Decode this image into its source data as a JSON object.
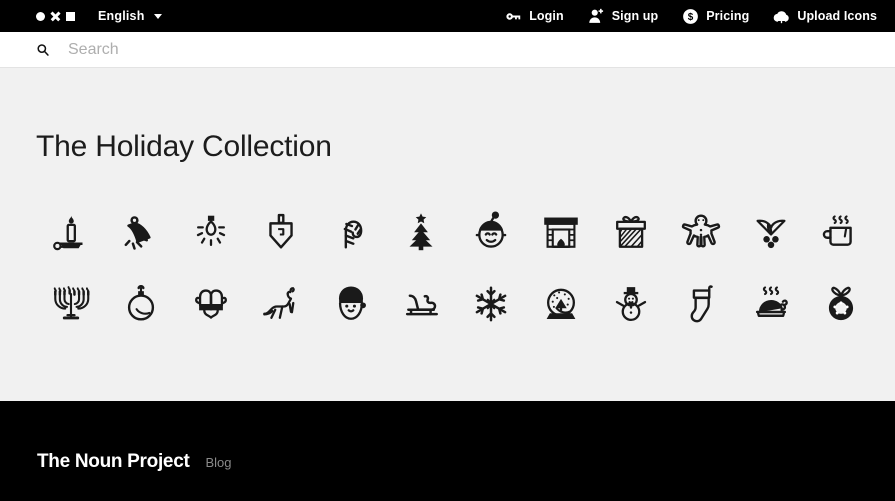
{
  "topbar": {
    "logo": {
      "name": "noun-project-logo",
      "shapes": [
        "circle",
        "x",
        "square"
      ]
    },
    "language": {
      "label": "English",
      "caret_icon": "chevron-down-icon"
    },
    "nav": [
      {
        "label": "Login",
        "icon": "key-icon"
      },
      {
        "label": "Sign up",
        "icon": "person-add-icon"
      },
      {
        "label": "Pricing",
        "icon": "dollar-circle-icon"
      },
      {
        "label": "Upload Icons",
        "icon": "cloud-upload-icon"
      }
    ]
  },
  "search": {
    "icon": "search-icon",
    "value": "",
    "placeholder": "Search"
  },
  "main": {
    "title": "The Holiday Collection",
    "icons": [
      {
        "name": "candle-icon",
        "label": "Candle"
      },
      {
        "name": "bell-icon",
        "label": "Bell"
      },
      {
        "name": "christmas-light-icon",
        "label": "Christmas Light"
      },
      {
        "name": "dreidel-icon",
        "label": "Dreidel"
      },
      {
        "name": "candy-cane-icon",
        "label": "Candy Cane"
      },
      {
        "name": "christmas-tree-icon",
        "label": "Christmas Tree"
      },
      {
        "name": "elf-icon",
        "label": "Elf"
      },
      {
        "name": "fireplace-icon",
        "label": "Fireplace"
      },
      {
        "name": "gift-icon",
        "label": "Gift"
      },
      {
        "name": "gingerbread-man-icon",
        "label": "Gingerbread Man"
      },
      {
        "name": "mistletoe-icon",
        "label": "Mistletoe"
      },
      {
        "name": "hot-cocoa-icon",
        "label": "Hot Cocoa"
      },
      {
        "name": "menorah-icon",
        "label": "Menorah"
      },
      {
        "name": "ornament-icon",
        "label": "Ornament"
      },
      {
        "name": "mittens-icon",
        "label": "Mittens"
      },
      {
        "name": "reindeer-icon",
        "label": "Reindeer"
      },
      {
        "name": "santa-icon",
        "label": "Santa"
      },
      {
        "name": "sleigh-icon",
        "label": "Sleigh"
      },
      {
        "name": "snowflake-icon",
        "label": "Snowflake"
      },
      {
        "name": "snow-globe-icon",
        "label": "Snow Globe"
      },
      {
        "name": "snowman-icon",
        "label": "Snowman"
      },
      {
        "name": "stocking-icon",
        "label": "Stocking"
      },
      {
        "name": "roast-turkey-icon",
        "label": "Roast Turkey"
      },
      {
        "name": "wreath-icon",
        "label": "Wreath"
      }
    ]
  },
  "footer": {
    "brand": "The Noun Project",
    "link": "Blog"
  },
  "colors": {
    "topbar_bg": "#000000",
    "footer_bg": "#000000",
    "page_bg": "#f1f1f1",
    "search_bg": "#ffffff",
    "icon_fill": "#1a1a1a",
    "muted_text": "#8a8a8a"
  }
}
